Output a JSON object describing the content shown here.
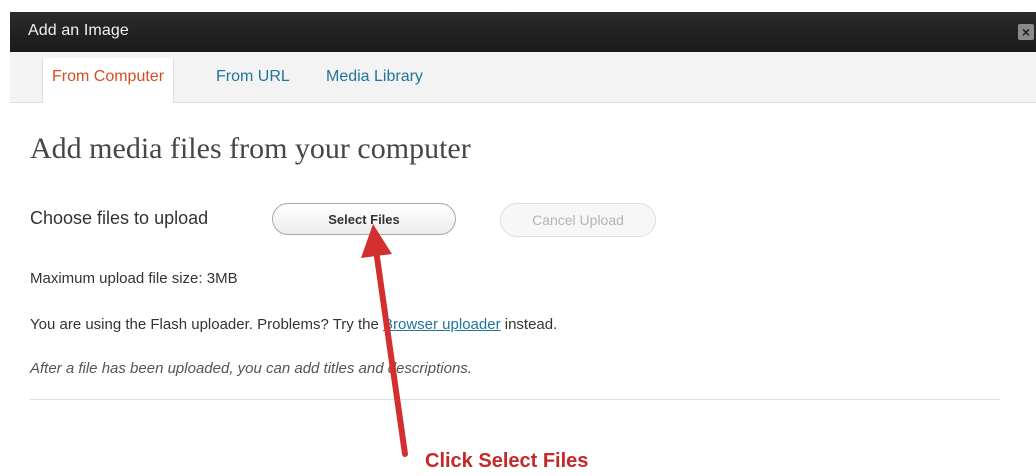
{
  "window": {
    "title": "Add an Image",
    "close_glyph": "×",
    "close_icon": "close-icon"
  },
  "tabs": [
    {
      "label": "From Computer",
      "active": true
    },
    {
      "label": "From URL",
      "active": false
    },
    {
      "label": "Media Library",
      "active": false
    }
  ],
  "main": {
    "heading": "Add media files from your computer",
    "choose_label": "Choose files to upload",
    "select_files_label": "Select Files",
    "cancel_upload_label": "Cancel Upload",
    "max_size_text": "Maximum upload file size: 3MB",
    "flash_text_before": "You are using the Flash uploader. Problems? Try the ",
    "flash_link": "Browser uploader",
    "flash_text_after": " instead.",
    "after_upload_note": "After a file has been uploaded, you can add titles and descriptions."
  },
  "annotation": {
    "text": "Click Select Files",
    "color": "#c62828"
  },
  "colors": {
    "titlebar": "#1e1e1e",
    "link": "#21759b",
    "active_tab": "#d54e21",
    "arrow": "#d32f2f"
  }
}
